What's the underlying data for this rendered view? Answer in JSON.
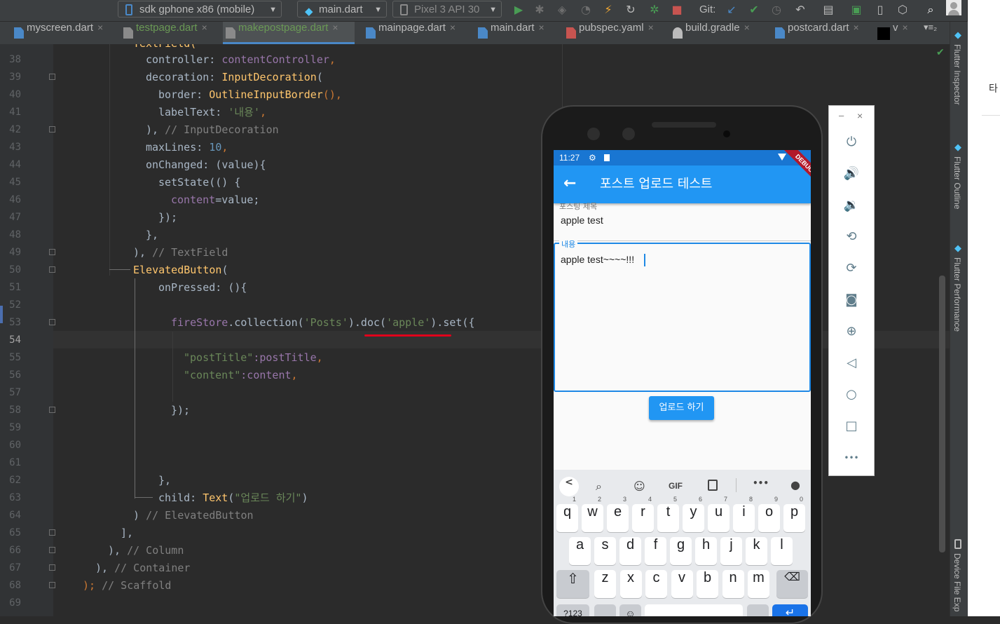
{
  "toolbar": {
    "device_select": "sdk gphone x86 (mobile)",
    "config_select": "main.dart",
    "avd_select": "Pixel 3 API 30",
    "git_label": "Git:"
  },
  "tabs": [
    {
      "label": "myscreen.dart"
    },
    {
      "label": "testpage.dart"
    },
    {
      "label": "makepostpage.dart"
    },
    {
      "label": "mainpage.dart"
    },
    {
      "label": "main.dart"
    },
    {
      "label": "pubspec.yaml"
    },
    {
      "label": "build.gradle"
    },
    {
      "label": "postcard.dart"
    },
    {
      "label": "v"
    }
  ],
  "tab_close": "×",
  "tab_menu": "▾≡₂",
  "editor": {
    "line_numbers": [
      "38",
      "39",
      "40",
      "41",
      "42",
      "43",
      "44",
      "45",
      "46",
      "47",
      "48",
      "49",
      "50",
      "51",
      "52",
      "53",
      "54",
      "55",
      "56",
      "57",
      "58",
      "59",
      "60",
      "61",
      "62",
      "63",
      "64",
      "65",
      "66",
      "67",
      "68",
      "69"
    ],
    "current_line": "54"
  },
  "code": {
    "l38": [
      "controller: ",
      "contentController",
      ","
    ],
    "l39": [
      "decoration: ",
      "InputDecoration",
      "("
    ],
    "l40": [
      "border: ",
      "OutlineInputBorder",
      "(),"
    ],
    "l41": [
      "labelText: ",
      "'내용'",
      ","
    ],
    "l42": [
      "), ",
      "// InputDecoration"
    ],
    "l43": [
      "maxLines: ",
      "10",
      ","
    ],
    "l44": [
      "onChanged: (value){"
    ],
    "l45": [
      "setState(() {"
    ],
    "l46": [
      "content",
      "=value;"
    ],
    "l47": [
      "});"
    ],
    "l48": [
      "},"
    ],
    "l49": [
      "), ",
      "// TextField"
    ],
    "l50": [
      "ElevatedButton",
      "("
    ],
    "l51": [
      "onPressed: (){"
    ],
    "l53": [
      "fireStore",
      ".collection(",
      "'Posts'",
      ").doc(",
      "'apple'",
      ").set({"
    ],
    "l55": [
      "\"postTitle\"",
      ":postTitle",
      ","
    ],
    "l56": [
      "\"content\"",
      ":content",
      ","
    ],
    "l58": [
      "});"
    ],
    "l62": [
      "},"
    ],
    "l63": [
      "child: ",
      "Text",
      "(",
      "\"업로드 하기\"",
      ")"
    ],
    "l64": [
      ") ",
      "// ElevatedButton"
    ],
    "l65": [
      "],"
    ],
    "l66": [
      "), ",
      "// Column"
    ],
    "l67": [
      "), ",
      "// Container"
    ],
    "l68": [
      ");",
      " // Scaffold"
    ],
    "l37_partial": "TextField("
  },
  "right_tools": {
    "inspector": "Flutter Inspector",
    "outline": "Flutter Outline",
    "performance": "Flutter Performance",
    "device_file": "Device File Exp"
  },
  "far_right_text": "타",
  "phone": {
    "status_time": "11:27",
    "debug_banner": "DEBUG",
    "appbar_title": "포스트 업로드 테스트",
    "title_label": "포스팅 제목",
    "title_value": "apple test",
    "content_label": "내용",
    "content_value": "apple test~~~~!!!",
    "upload_button": "업로드 하기",
    "kb_tools": [
      "<",
      "🔍",
      "☺",
      "GIF",
      "📋",
      "•••",
      "🎤"
    ],
    "row1": [
      "q",
      "w",
      "e",
      "r",
      "t",
      "y",
      "u",
      "i",
      "o",
      "p"
    ],
    "row1_nums": [
      "1",
      "2",
      "3",
      "4",
      "5",
      "6",
      "7",
      "8",
      "9",
      "0"
    ],
    "row2": [
      "a",
      "s",
      "d",
      "f",
      "g",
      "h",
      "j",
      "k",
      "l"
    ],
    "row3": [
      "z",
      "x",
      "c",
      "v",
      "b",
      "n",
      "m"
    ],
    "row4_left": "?123"
  },
  "emulator_panel": {
    "minimize": "–",
    "close": "×",
    "more": "•••"
  }
}
